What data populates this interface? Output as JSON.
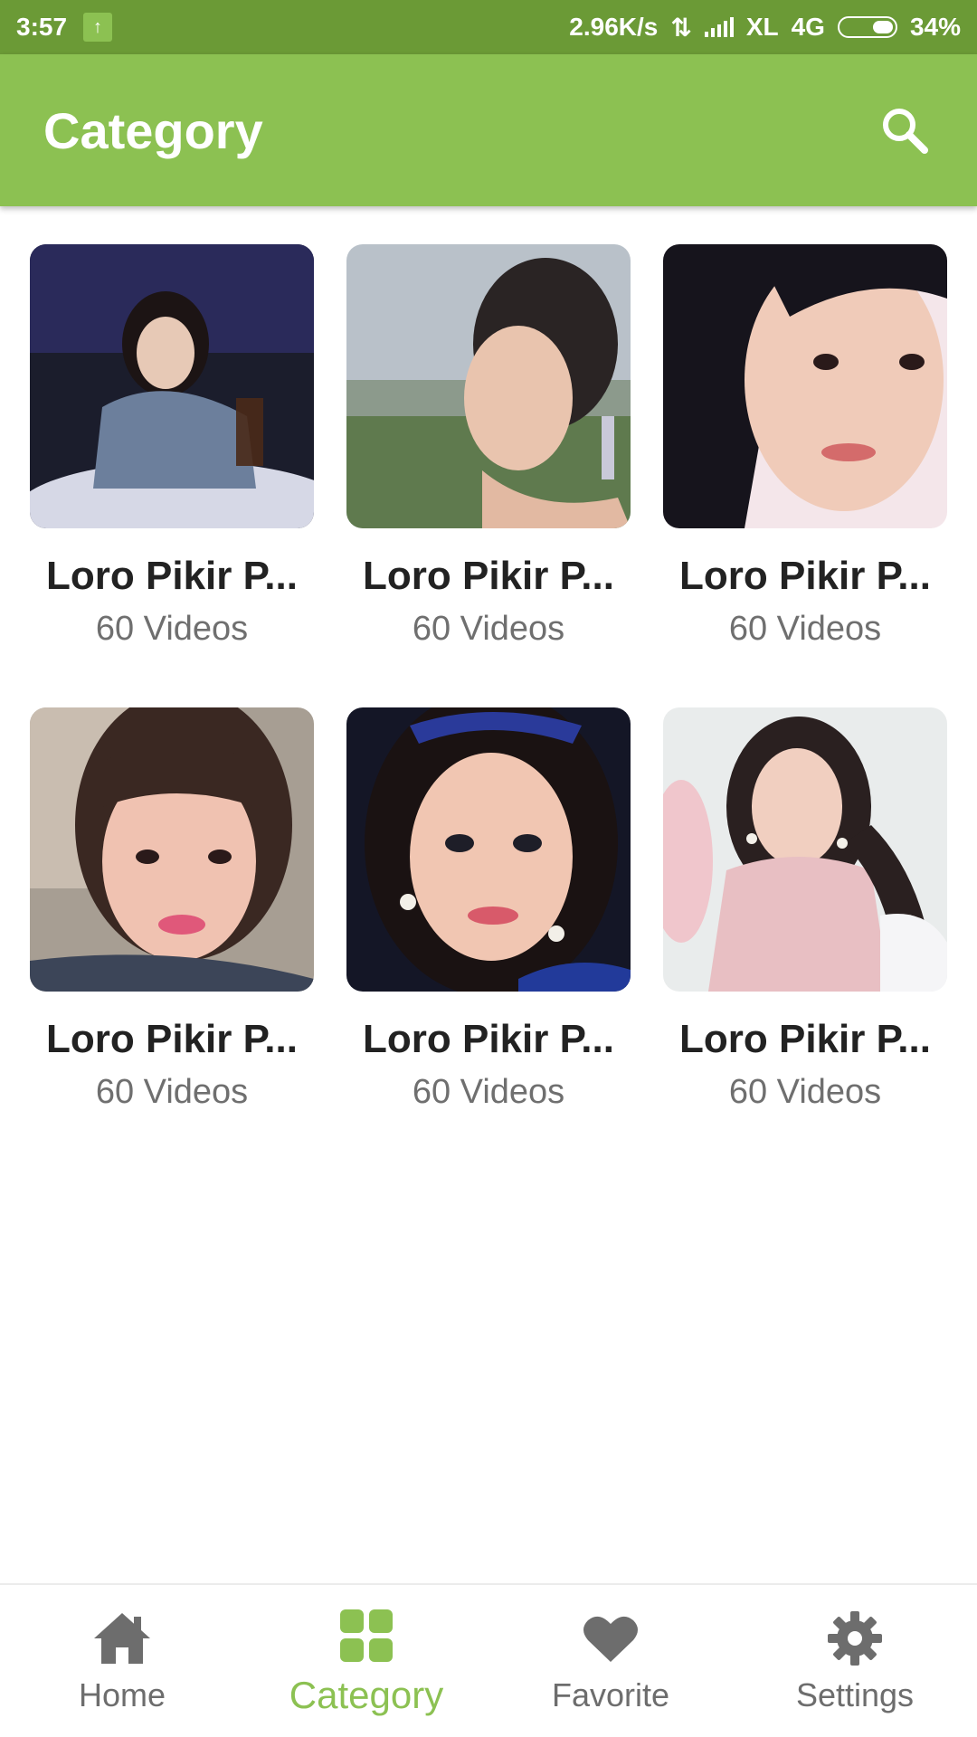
{
  "status_bar": {
    "time": "3:57",
    "speed": "2.96K/s",
    "carrier": "XL",
    "network": "4G",
    "battery": "34%"
  },
  "app_bar": {
    "title": "Category"
  },
  "categories": [
    {
      "title": "Loro Pikir P...",
      "count": "60 Videos"
    },
    {
      "title": "Loro Pikir P...",
      "count": "60 Videos"
    },
    {
      "title": "Loro Pikir P...",
      "count": "60 Videos"
    },
    {
      "title": "Loro Pikir P...",
      "count": "60 Videos"
    },
    {
      "title": "Loro Pikir P...",
      "count": "60 Videos"
    },
    {
      "title": "Loro Pikir P...",
      "count": "60 Videos"
    }
  ],
  "bottom_nav": {
    "items": [
      {
        "label": "Home",
        "icon": "home-icon"
      },
      {
        "label": "Category",
        "icon": "category-grid-icon"
      },
      {
        "label": "Favorite",
        "icon": "heart-icon"
      },
      {
        "label": "Settings",
        "icon": "gear-icon"
      }
    ],
    "active": "Category"
  },
  "colors": {
    "primary": "#8cc152",
    "status_bar": "#6b9a36",
    "inactive": "#6d6d6d"
  }
}
